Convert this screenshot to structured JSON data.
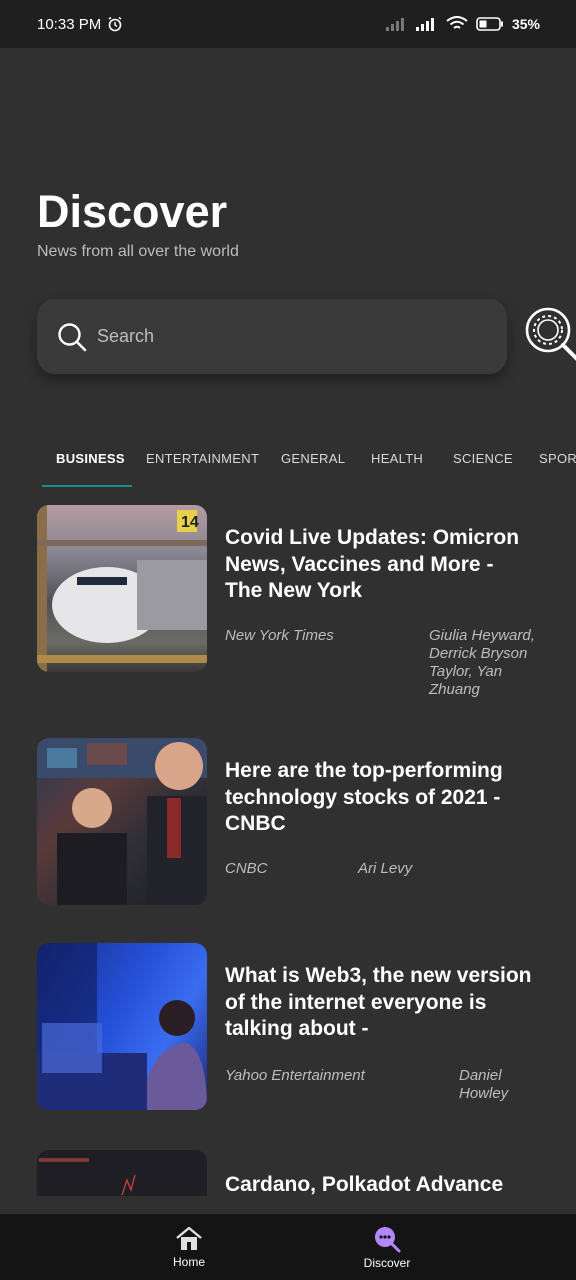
{
  "status_bar": {
    "time": "10:33 PM",
    "battery": "35%"
  },
  "header": {
    "title": "Discover",
    "subtitle": "News from all over the world"
  },
  "search": {
    "placeholder": "Search"
  },
  "tabs": [
    {
      "label": "BUSINESS",
      "active": true
    },
    {
      "label": "ENTERTAINMENT",
      "active": false
    },
    {
      "label": "GENERAL",
      "active": false
    },
    {
      "label": "HEALTH",
      "active": false
    },
    {
      "label": "SCIENCE",
      "active": false
    },
    {
      "label": "SPORTS",
      "active": false
    }
  ],
  "articles": [
    {
      "title": "Covid Live Updates: Omicron News, Vaccines and More - The New York",
      "source": "New York Times",
      "author": "Giulia Heyward, Derrick Bryson Taylor, Yan Zhuang"
    },
    {
      "title": "Here are the top-performing technology stocks of 2021 - CNBC",
      "source": "CNBC",
      "author": "Ari Levy"
    },
    {
      "title": "What is Web3, the new version of the internet everyone is talking about -",
      "source": "Yahoo Entertainment",
      "author": "Daniel Howley"
    },
    {
      "title": "Cardano, Polkadot Advance",
      "source": "",
      "author": ""
    }
  ],
  "bottom_nav": [
    {
      "label": "Home",
      "icon": "home-icon",
      "active": false
    },
    {
      "label": "Discover",
      "icon": "discover-icon",
      "active": true
    }
  ],
  "colors": {
    "background": "#303030",
    "accent": "#1e8c8a",
    "nav_active": "#b388ff"
  }
}
